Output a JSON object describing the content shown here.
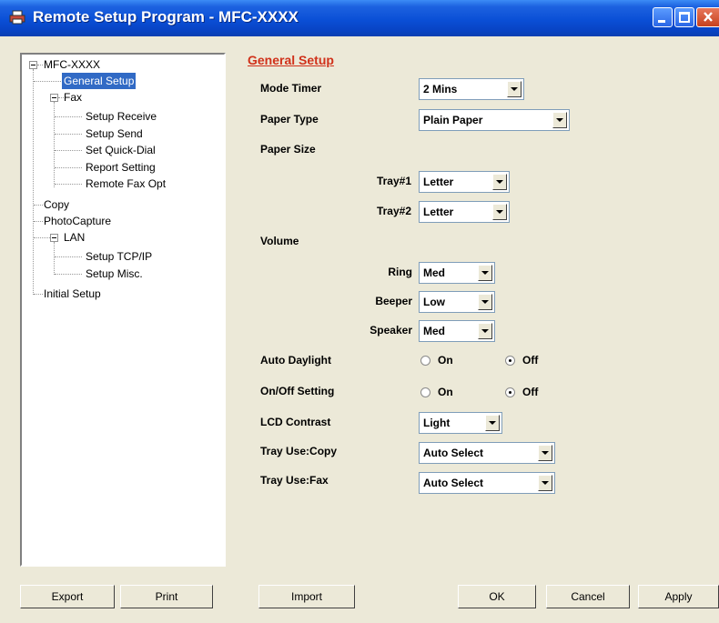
{
  "window": {
    "title": "Remote Setup Program - MFC-XXXX"
  },
  "tree": {
    "root": "MFC-XXXX",
    "general_setup": "General Setup",
    "fax": "Fax",
    "setup_receive": "Setup Receive",
    "setup_send": "Setup Send",
    "set_quick_dial": "Set Quick-Dial",
    "report_setting": "Report Setting",
    "remote_fax_opt": "Remote Fax Opt",
    "copy": "Copy",
    "photocapture": "PhotoCapture",
    "lan": "LAN",
    "setup_tcpip": "Setup TCP/IP",
    "setup_misc": "Setup Misc.",
    "initial_setup": "Initial Setup"
  },
  "panel": {
    "heading": "General Setup",
    "mode_timer": {
      "label": "Mode Timer",
      "value": "2 Mins"
    },
    "paper_type": {
      "label": "Paper Type",
      "value": "Plain Paper"
    },
    "paper_size": {
      "label": "Paper Size"
    },
    "tray1": {
      "label": "Tray#1",
      "value": "Letter"
    },
    "tray2": {
      "label": "Tray#2",
      "value": "Letter"
    },
    "volume": {
      "label": "Volume"
    },
    "ring": {
      "label": "Ring",
      "value": "Med"
    },
    "beeper": {
      "label": "Beeper",
      "value": "Low"
    },
    "speaker": {
      "label": "Speaker",
      "value": "Med"
    },
    "auto_daylight": {
      "label": "Auto Daylight",
      "on": "On",
      "off": "Off",
      "selected": "Off"
    },
    "onoff_setting": {
      "label": "On/Off Setting",
      "on": "On",
      "off": "Off",
      "selected": "Off"
    },
    "lcd_contrast": {
      "label": "LCD Contrast",
      "value": "Light"
    },
    "tray_use_copy": {
      "label": "Tray Use:Copy",
      "value": "Auto Select"
    },
    "tray_use_fax": {
      "label": "Tray Use:Fax",
      "value": "Auto Select"
    }
  },
  "buttons": {
    "export": "Export",
    "print": "Print",
    "import": "Import",
    "ok": "OK",
    "cancel": "Cancel",
    "apply": "Apply"
  },
  "colors": {
    "title_bar": "#0a4fd6",
    "heading": "#d0311a",
    "selection": "#316ac5",
    "face": "#ece9d8"
  }
}
